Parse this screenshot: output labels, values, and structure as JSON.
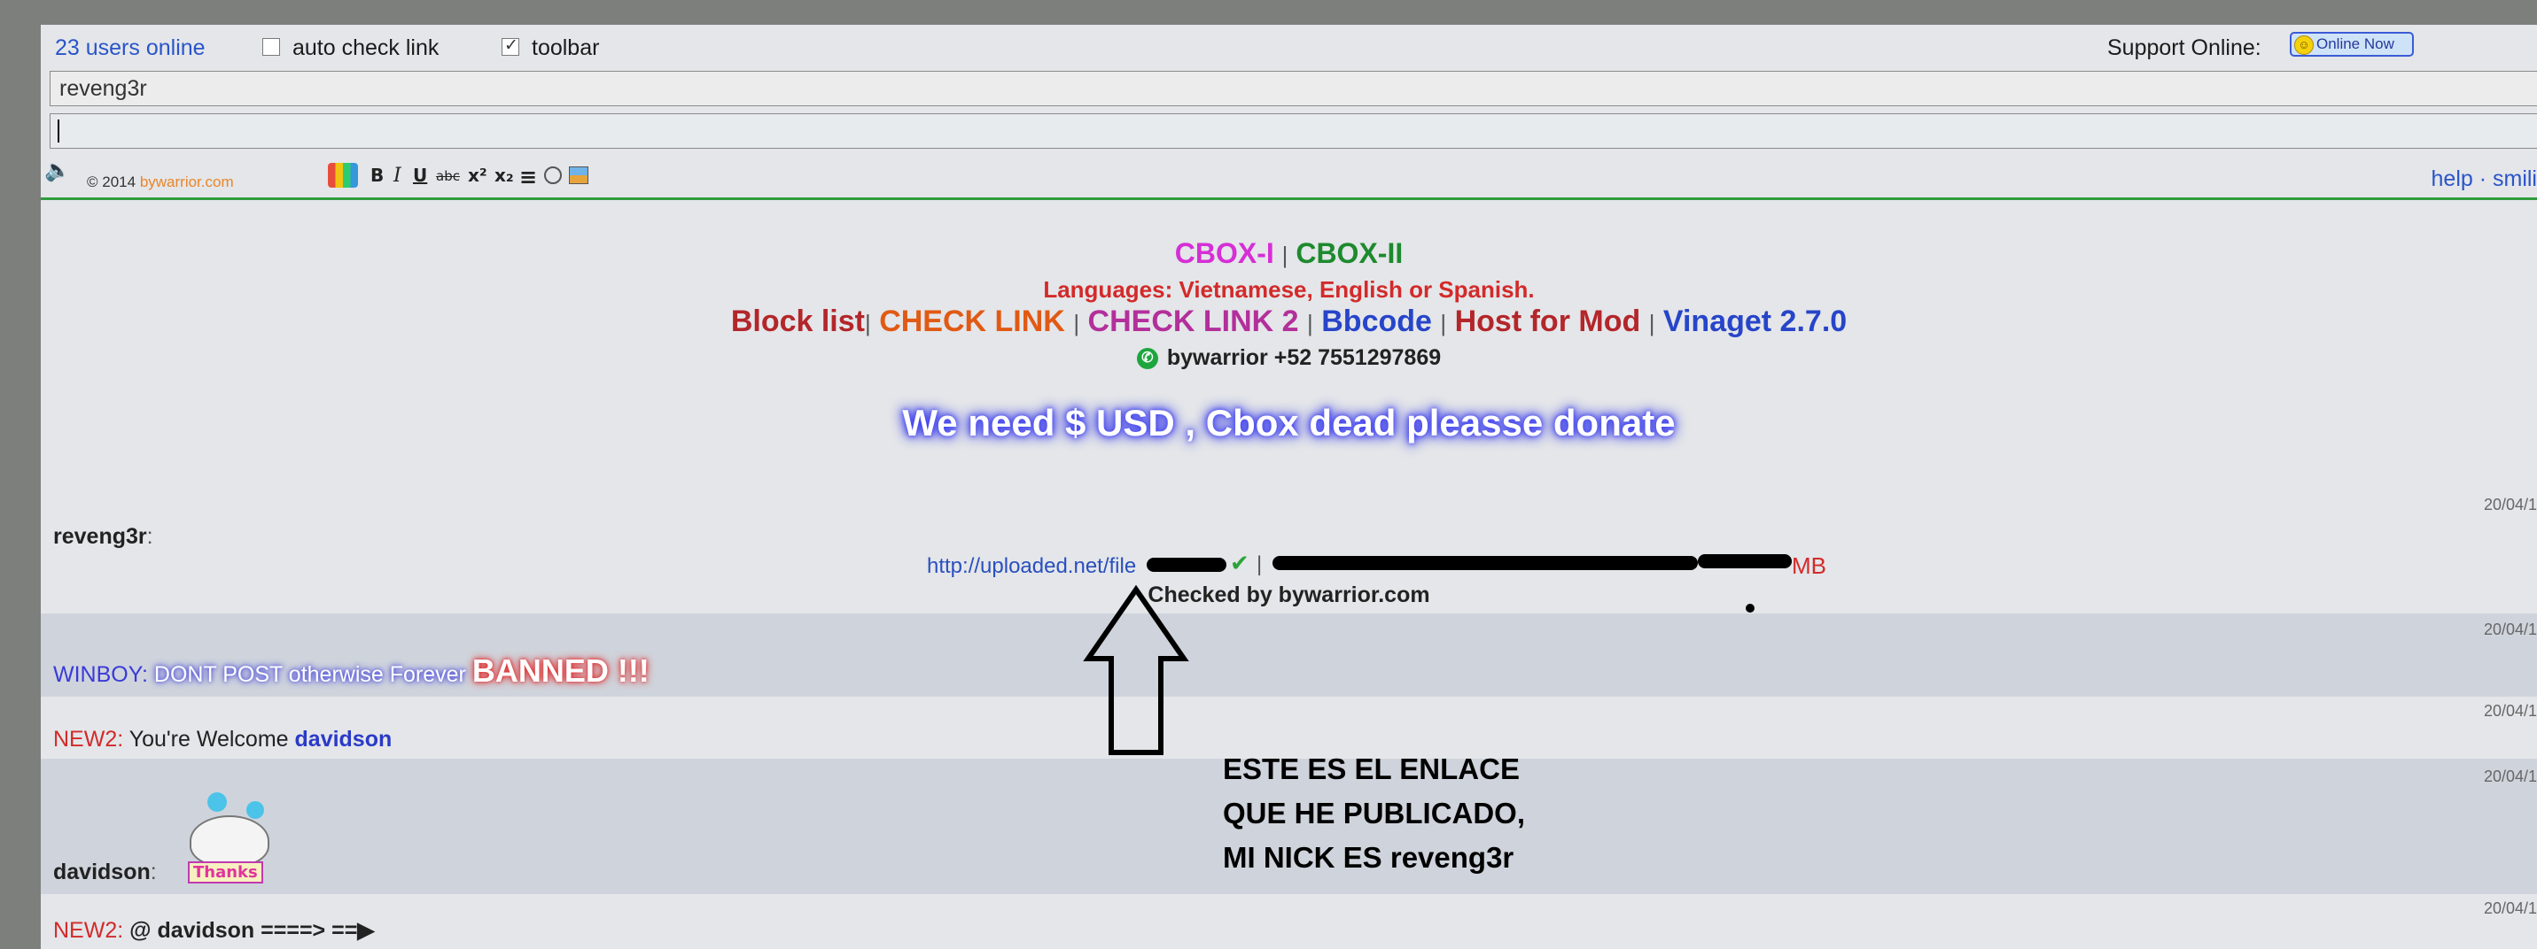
{
  "topbar": {
    "users_online": "23 users online",
    "auto_check_label": "auto check link",
    "auto_check_checked": false,
    "toolbar_label": "toolbar",
    "toolbar_checked": true,
    "support_label": "Support Online:",
    "online_now_badge": "Online Now"
  },
  "nick_field": {
    "value": "reveng3r"
  },
  "message_field": {
    "value": ""
  },
  "toolbar": {
    "copyright": "© 2014",
    "brand": "bywarrior.com",
    "bold": "B",
    "italic": "I",
    "underline": "U",
    "strike": "abc",
    "superscript": "x²",
    "subscript": "x₂",
    "align": "≡",
    "right_links": "help · smili",
    "icons": [
      "speaker-icon",
      "color-grid-icon",
      "bold-icon",
      "italic-icon",
      "underline-icon",
      "strike-icon",
      "superscript-icon",
      "subscript-icon",
      "align-icon",
      "emoji-icon",
      "image-icon"
    ]
  },
  "header": {
    "cbox1": "CBOX-I",
    "cbox_sep": "|",
    "cbox2": "CBOX-II",
    "languages": "Languages: Vietnamese, English or Spanish.",
    "links": [
      {
        "label": "Block list",
        "color": "#b3262a"
      },
      {
        "label": "CHECK LINK",
        "color": "#e05a14"
      },
      {
        "label": "CHECK LINK 2",
        "color": "#b32f9b"
      },
      {
        "label": "Bbcode",
        "color": "#2745c9"
      },
      {
        "label": "Host for Mod",
        "color": "#b3262a"
      },
      {
        "label": "Vinaget 2.7.0",
        "color": "#2745c9"
      }
    ],
    "whatsapp": "bywarrior +52 7551297869",
    "donate": "We need $ USD , Cbox dead pleasse donate"
  },
  "messages": [
    {
      "nick": "reveng3r",
      "color": "#222222",
      "timestamp": "20/04/1",
      "link": "http://uploaded.net/file",
      "size_suffix": "MB",
      "checked_by": "Checked by bywarrior.com"
    },
    {
      "nick": "WINBOY",
      "color": "#3a3ad8",
      "timestamp": "20/04/1",
      "text": "DONT POST otherwise Forever",
      "banned": "BANNED !!!"
    },
    {
      "nick": "NEW2",
      "color": "#d32a2a",
      "timestamp": "20/04/1",
      "text": "You're Welcome",
      "mention": "davidson"
    },
    {
      "nick": "davidson",
      "color": "#222222",
      "timestamp": "20/04/1",
      "sticker": "Thanks"
    },
    {
      "nick": "NEW2",
      "color": "#d32a2a",
      "timestamp": "20/04/1",
      "text": "@ davidson ====> ==▶"
    }
  ],
  "annotation": {
    "line1": "ESTE ES EL ENLACE",
    "line2": "QUE HE PUBLICADO,",
    "line3": "MI NICK ES reveng3r"
  }
}
